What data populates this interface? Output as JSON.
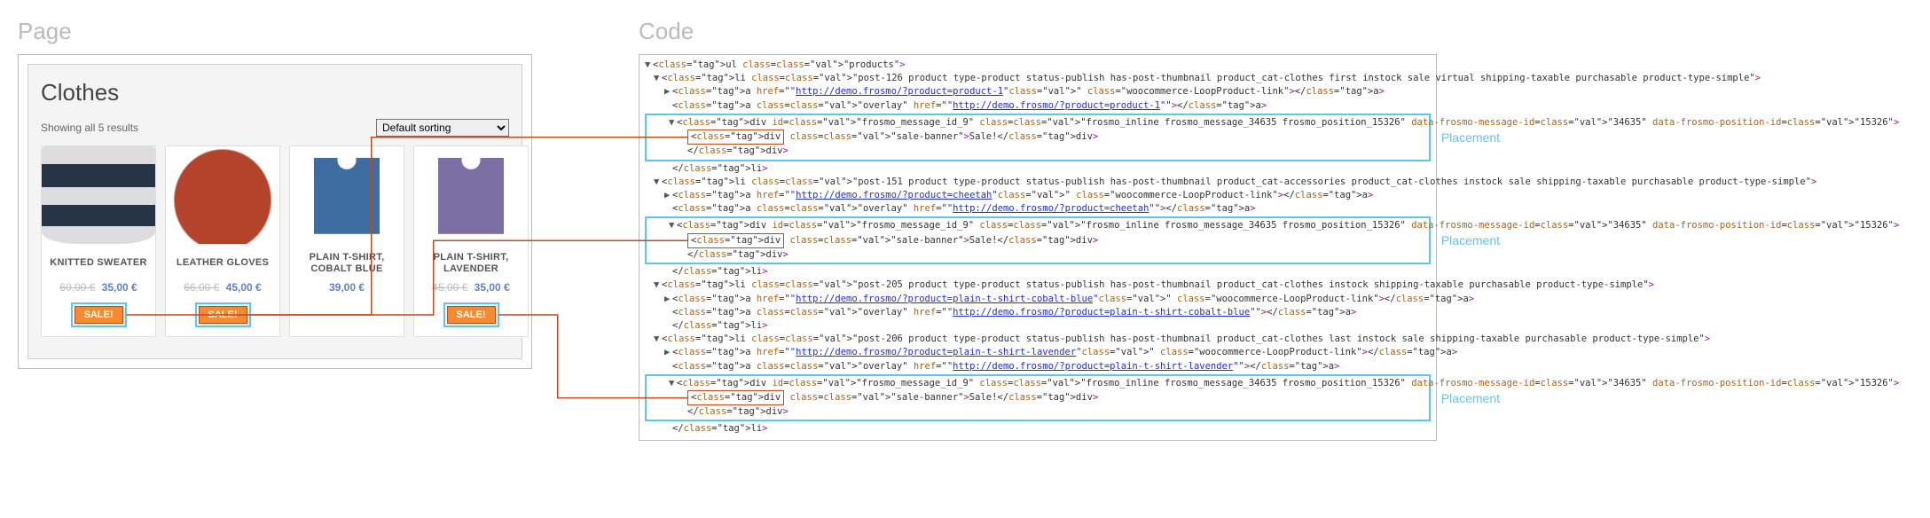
{
  "headers": {
    "page": "Page",
    "code": "Code"
  },
  "shop": {
    "title": "Clothes",
    "results": "Showing all 5 results",
    "sort_default": "Default sorting"
  },
  "products": [
    {
      "title": "KNITTED SWEATER",
      "old": "60,00 €",
      "new": "35,00 €",
      "sale": true
    },
    {
      "title": "LEATHER GLOVES",
      "old": "66,00 €",
      "new": "45,00 €",
      "sale": true
    },
    {
      "title": "PLAIN T-SHIRT, COBALT BLUE",
      "old": "",
      "new": "39,00 €",
      "sale": false
    },
    {
      "title": "PLAIN T-SHIRT, LAVENDER",
      "old": "45,00 €",
      "new": "35,00 €",
      "sale": true
    }
  ],
  "sale_label": "SALE!",
  "placement_label": "Placement",
  "code": {
    "ul_open": "<ul class=\"products\">",
    "li": {
      "p1": "<li class=\"post-126 product type-product status-publish has-post-thumbnail product_cat-clothes first instock sale virtual shipping-taxable purchasable product-type-simple\">",
      "p2": "<li class=\"post-151 product type-product status-publish has-post-thumbnail product_cat-accessories product_cat-clothes  instock sale shipping-taxable purchasable product-type-simple\">",
      "p3": "<li class=\"post-205 product type-product status-publish has-post-thumbnail product_cat-clothes  instock shipping-taxable purchasable product-type-simple\">",
      "p4": "<li class=\"post-206 product type-product status-publish has-post-thumbnail product_cat-clothes last instock sale shipping-taxable purchasable product-type-simple\">"
    },
    "a_href_prefix": "<a href=\"",
    "a_href_suffix": "\" class=\"woocommerce-LoopProduct-link\"></a>",
    "overlay_prefix": "<a class=\"overlay\" href=\"",
    "overlay_suffix": "\"></a>",
    "urls": {
      "p1": "http://demo.frosmo/?product=product-1",
      "p2": "http://demo.frosmo/?product=cheetah",
      "p3": "http://demo.frosmo/?product=plain-t-shirt-cobalt-blue",
      "p4": "http://demo.frosmo/?product=plain-t-shirt-lavender"
    },
    "frosmo_div": "<div id=\"frosmo_message_id_9\" class=\"frosmo_inline frosmo_message_34635 frosmo_position_15326\" data-frosmo-message-id=\"34635\" data-frosmo-position-id=\"15326\">",
    "sale_div": "<div class=\"sale-banner\">Sale!</div>",
    "div_close": "</div>",
    "li_close": "</li>"
  }
}
